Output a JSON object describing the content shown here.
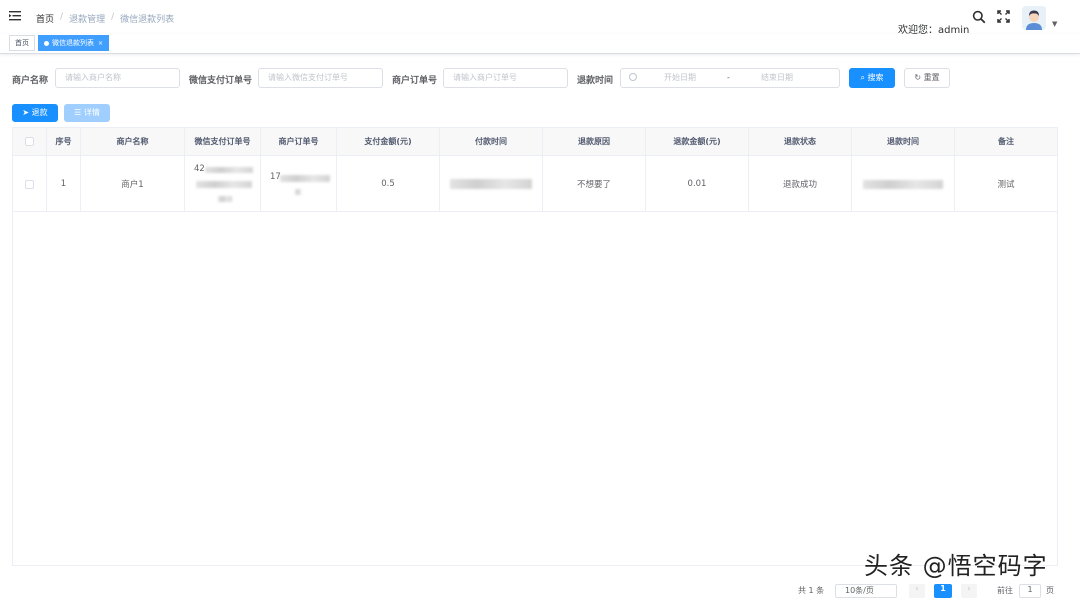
{
  "header": {
    "breadcrumb": [
      "首页",
      "退款管理",
      "微信退款列表"
    ],
    "breadcrumb_sep": "/",
    "welcome": "欢迎您：admin"
  },
  "tags": [
    {
      "label": "首页"
    },
    {
      "label": "微信退款列表",
      "close": "×"
    }
  ],
  "search": {
    "merchant_label": "商户名称",
    "merchant_placeholder": "请输入商户名称",
    "wx_order_label": "微信支付订单号",
    "wx_order_placeholder": "请输入微信支付订单号",
    "merchant_order_label": "商户订单号",
    "merchant_order_placeholder": "请输入商户订单号",
    "refund_time_label": "退款时间",
    "start_placeholder": "开始日期",
    "range_sep": "-",
    "end_placeholder": "结束日期",
    "search_btn": "搜索",
    "reset_btn": "重置"
  },
  "toolbar": {
    "refund_btn": "退款",
    "detail_btn": "详情"
  },
  "table": {
    "columns": [
      "序号",
      "商户名称",
      "微信支付订单号",
      "商户订单号",
      "支付金额(元)",
      "付款时间",
      "退款原因",
      "退款金额(元)",
      "退款状态",
      "退款时间",
      "备注"
    ],
    "rows": [
      {
        "index": "1",
        "merchant": "商户1",
        "wx_order_prefix": "42",
        "merchant_order_prefix": "17",
        "pay_amount": "0.5",
        "reason": "不想要了",
        "refund_amount": "0.01",
        "status": "退款成功",
        "remark": "测试"
      }
    ]
  },
  "pagination": {
    "total": "共 1 条",
    "page_size": "10条/页",
    "current_page": "1",
    "goto_label": "前往",
    "goto_value": "1",
    "page_unit": "页"
  },
  "watermark": "头条 @悟空码字",
  "colors": {
    "primary": "#1890ff",
    "active_tag": "#409eff",
    "disabled": "#a0cfff"
  },
  "icons": {
    "menu": "hamburger-icon",
    "search": "search-icon",
    "fullscreen": "fullscreen-icon",
    "avatar": "avatar-icon"
  }
}
